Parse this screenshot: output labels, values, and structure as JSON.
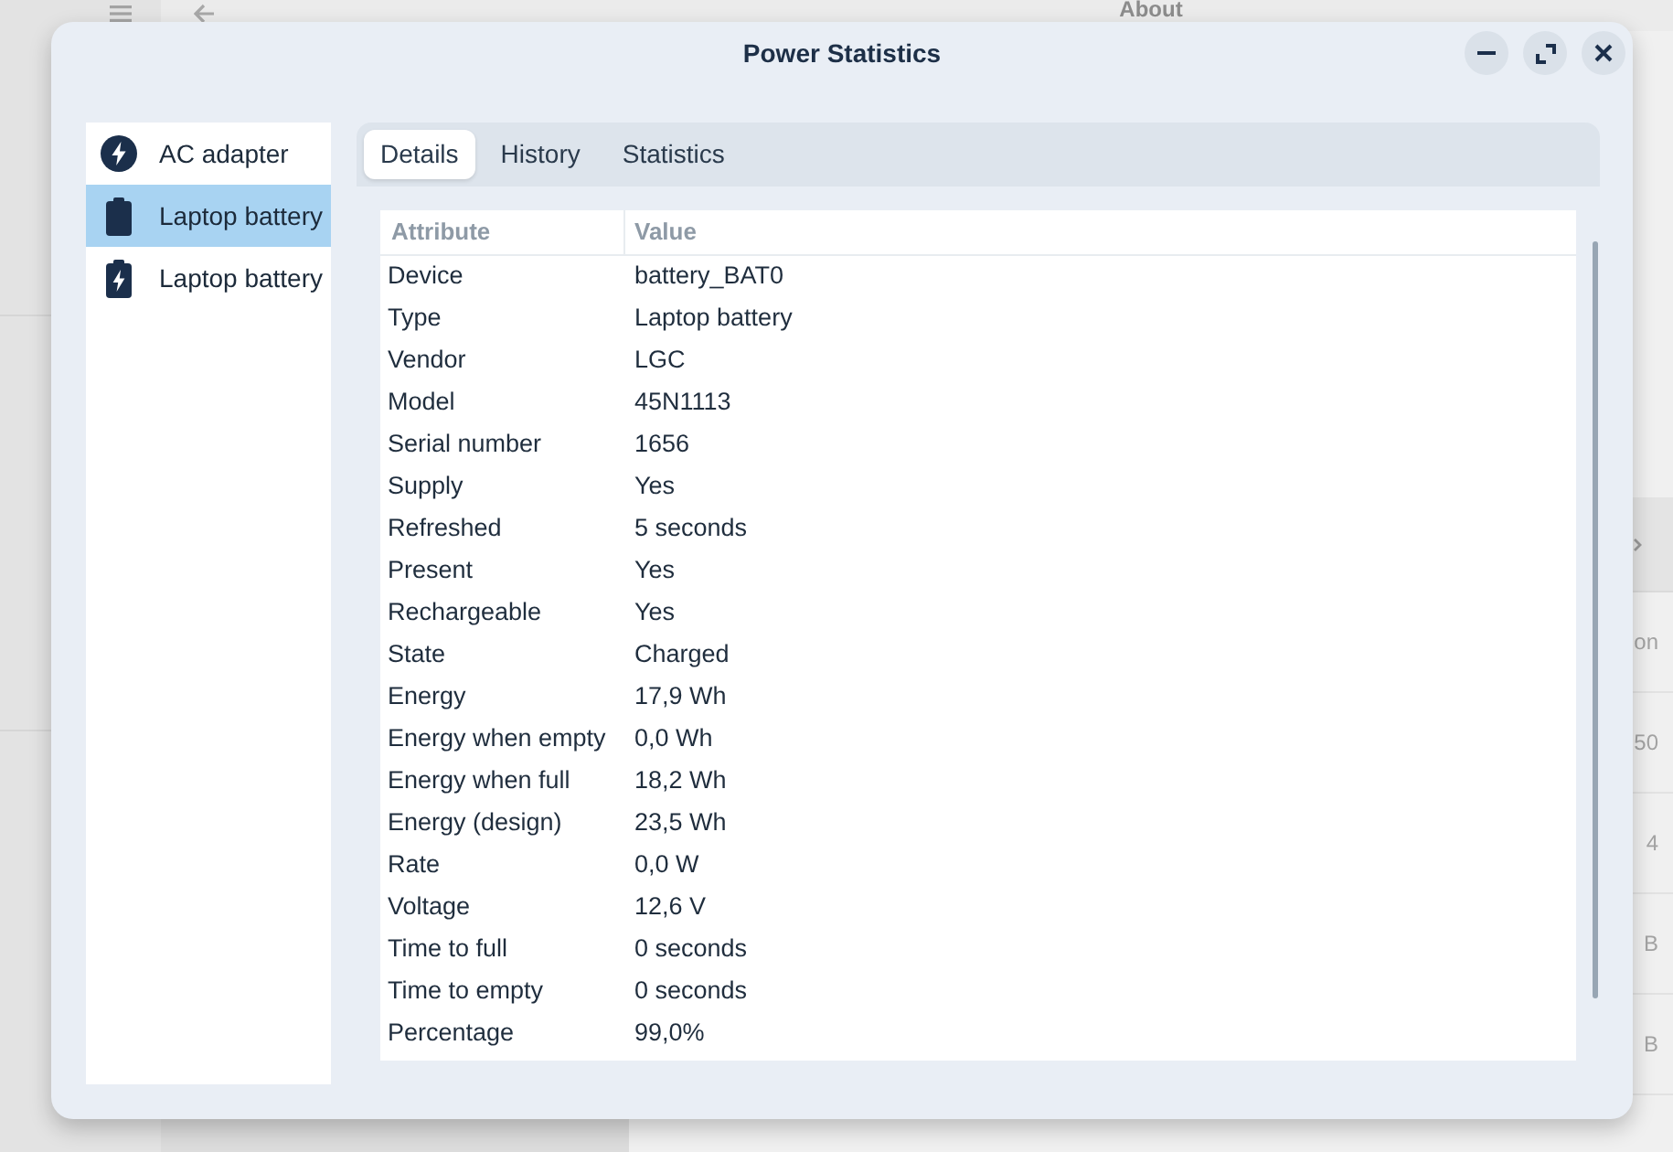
{
  "background_window": {
    "title": "About",
    "rows": [
      {
        "text": "on"
      },
      {
        "text": "50"
      },
      {
        "text": "4"
      },
      {
        "text": "B"
      },
      {
        "text": "B"
      }
    ]
  },
  "dialog": {
    "title": "Power Statistics"
  },
  "devices": [
    {
      "label": "AC adapter",
      "kind": "ac",
      "selected": false
    },
    {
      "label": "Laptop battery",
      "kind": "battery",
      "selected": true
    },
    {
      "label": "Laptop battery",
      "kind": "battery_charging",
      "selected": false
    }
  ],
  "tabs": [
    {
      "label": "Details",
      "selected": true
    },
    {
      "label": "History",
      "selected": false
    },
    {
      "label": "Statistics",
      "selected": false
    }
  ],
  "table": {
    "columns": [
      "Attribute",
      "Value"
    ],
    "rows": [
      [
        "Device",
        "battery_BAT0"
      ],
      [
        "Type",
        "Laptop battery"
      ],
      [
        "Vendor",
        "LGC"
      ],
      [
        "Model",
        "45N1113"
      ],
      [
        "Serial number",
        "1656"
      ],
      [
        "Supply",
        "Yes"
      ],
      [
        "Refreshed",
        "5 seconds"
      ],
      [
        "Present",
        "Yes"
      ],
      [
        "Rechargeable",
        "Yes"
      ],
      [
        "State",
        "Charged"
      ],
      [
        "Energy",
        "17,9 Wh"
      ],
      [
        "Energy when empty",
        "0,0 Wh"
      ],
      [
        "Energy when full",
        "18,2 Wh"
      ],
      [
        "Energy (design)",
        "23,5 Wh"
      ],
      [
        "Rate",
        "0,0 W"
      ],
      [
        "Voltage",
        "12,6 V"
      ],
      [
        "Time to full",
        "0 seconds"
      ],
      [
        "Time to empty",
        "0 seconds"
      ],
      [
        "Percentage",
        "99,0%"
      ]
    ]
  }
}
